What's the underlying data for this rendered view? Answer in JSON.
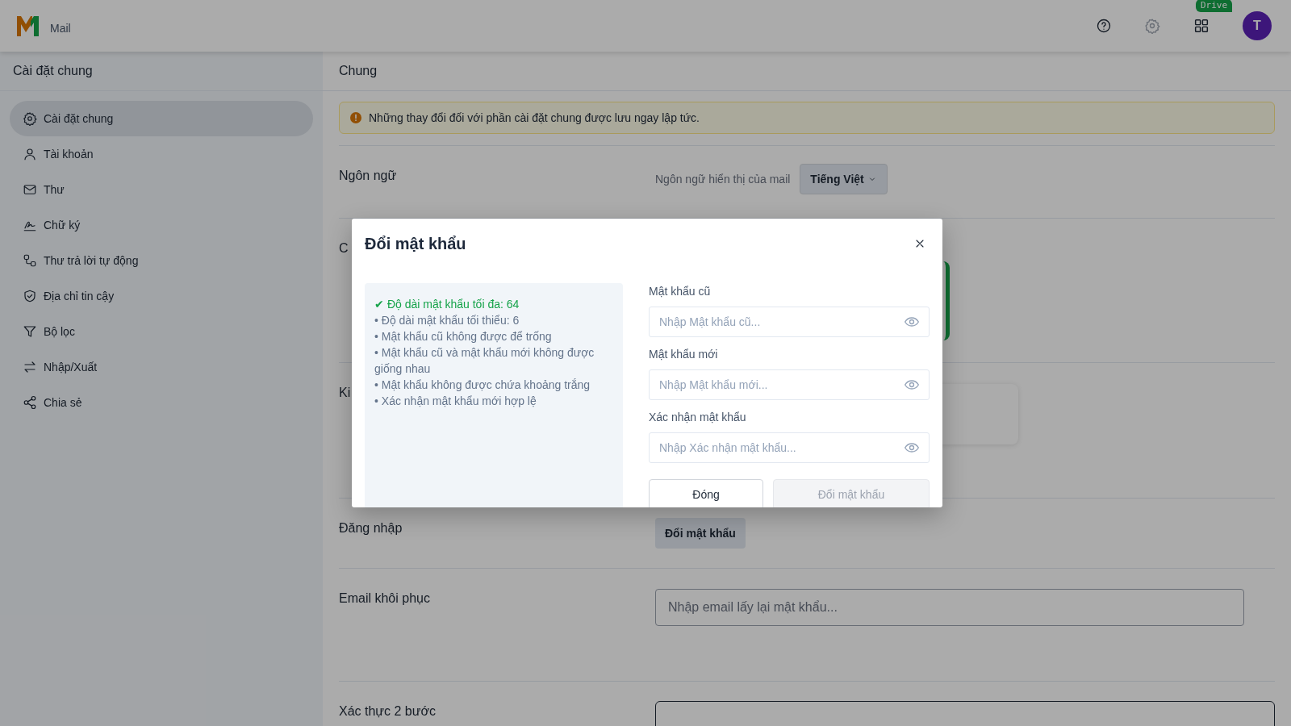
{
  "header": {
    "app_name": "Mail",
    "badge": "Drive",
    "avatar_initial": "T"
  },
  "sidebar": {
    "title": "Cài đặt chung",
    "items": [
      {
        "label": "Cài đặt chung",
        "selected": true
      },
      {
        "label": "Tài khoản",
        "selected": false
      },
      {
        "label": "Thư",
        "selected": false
      },
      {
        "label": "Chữ ký",
        "selected": false
      },
      {
        "label": "Thư trả lời tự động",
        "selected": false
      },
      {
        "label": "Địa chỉ tin cậy",
        "selected": false
      },
      {
        "label": "Bộ lọc",
        "selected": false
      },
      {
        "label": "Nhập/Xuất",
        "selected": false
      },
      {
        "label": "Chia sẻ",
        "selected": false
      }
    ]
  },
  "content": {
    "title": "Chung",
    "notice": "Những thay đổi đối với phần cài đặt chung được lưu ngay lập tức.",
    "sections": [
      {
        "kind": "language",
        "label": "Ngôn ngữ",
        "hint": "Ngôn ngữ hiển thị của mail",
        "value": "Tiếng Việt"
      },
      {
        "kind": "green-panel",
        "label": "C"
      },
      {
        "kind": "card",
        "label": "Ki"
      },
      {
        "kind": "button",
        "label": "Đăng nhập",
        "button": "Đổi mật khẩu"
      },
      {
        "kind": "input",
        "label": "Email khôi phục",
        "placeholder": "Nhập email lấy lại mật khẩu..."
      },
      {
        "kind": "box",
        "label": "Xác thực 2 bước"
      }
    ]
  },
  "dialog": {
    "title": "Đổi mật khẩu",
    "rules": [
      {
        "text": "Độ dài mật khẩu tối đa: 64",
        "met": true
      },
      {
        "text": "Độ dài mật khẩu tối thiểu: 6",
        "met": false
      },
      {
        "text": "Mật khẩu cũ không được để trống",
        "met": false
      },
      {
        "text": "Mật khẩu cũ và mật khẩu mới không được giống nhau",
        "met": false
      },
      {
        "text": "Mật khẩu không được chứa khoảng trắng",
        "met": false
      },
      {
        "text": "Xác nhận mật khẩu mới hợp lệ",
        "met": false
      }
    ],
    "marks": {
      "met": "✔",
      "unmet": "•"
    },
    "fields": [
      {
        "label": "Mật khẩu cũ",
        "placeholder": "Nhập Mật khẩu cũ..."
      },
      {
        "label": "Mật khẩu mới",
        "placeholder": "Nhập Mật khẩu mới..."
      },
      {
        "label": "Xác nhận mật khẩu",
        "placeholder": "Nhập Xác nhận mật khẩu..."
      }
    ],
    "buttons": [
      {
        "label": "Đóng",
        "disabled": false
      },
      {
        "label": "Đổi mật khẩu",
        "disabled": true
      }
    ]
  }
}
